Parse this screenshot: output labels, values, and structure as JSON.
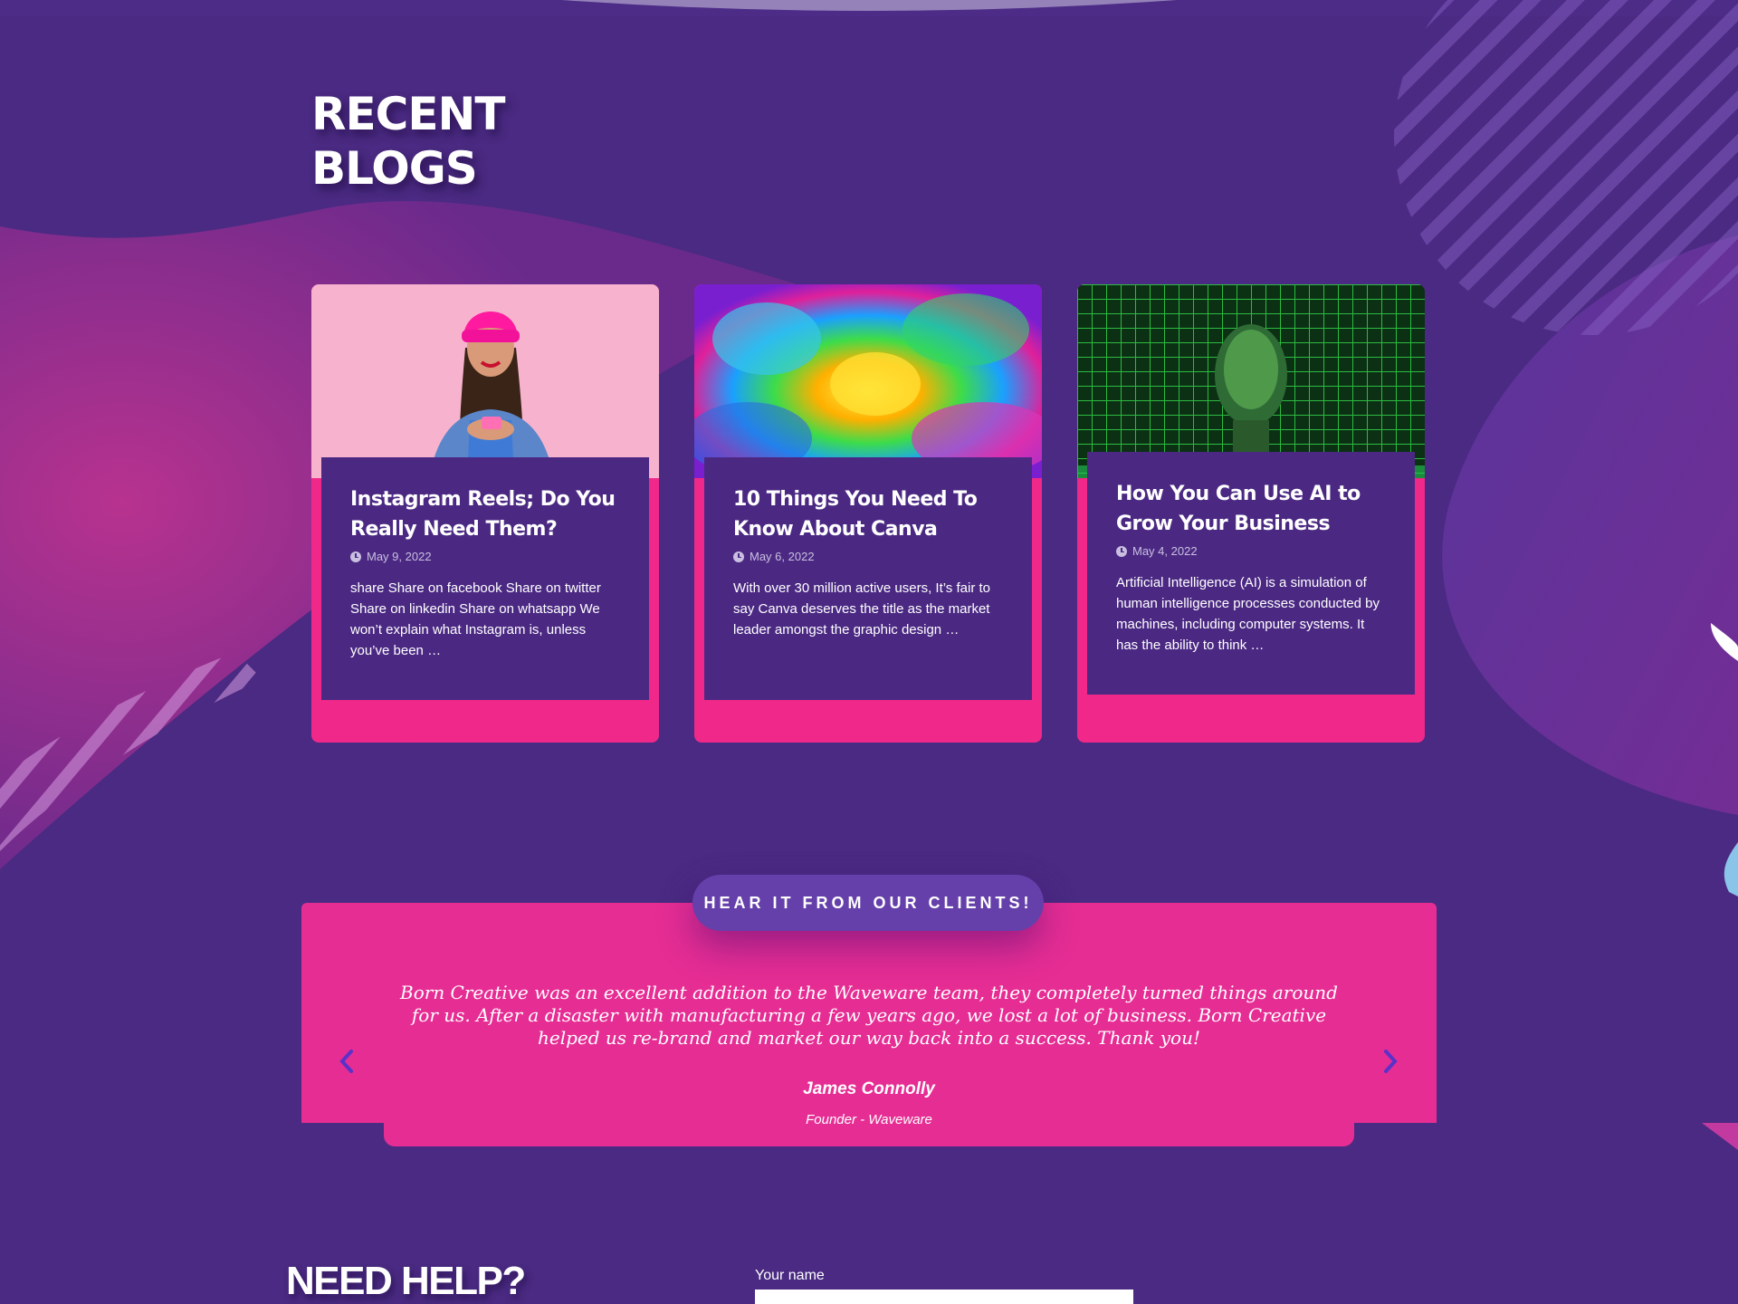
{
  "section": {
    "title_line1": "RECENT",
    "title_line2": "BLOGS"
  },
  "blogs": [
    {
      "title": "Instagram Reels; Do You Really Need Them?",
      "date": "May 9, 2022",
      "excerpt": "share Share on facebook Share on twitter Share on linkedin Share on whatsapp We won’t explain what Instagram is, unless you’ve been …",
      "image": "woman-with-phone-pink-beanie"
    },
    {
      "title": "10 Things You Need To Know About Canva",
      "date": "May 6, 2022",
      "excerpt": "With over 30 million active users, It’s fair to say Canva deserves the title as the market leader amongst the graphic design …",
      "image": "colorful-paint-explosion"
    },
    {
      "title": "How You Can Use AI to Grow Your Business",
      "date": "May 4, 2022",
      "excerpt": "Artificial Intelligence (AI) is a simulation of human intelligence processes conducted by machines, including computer systems. It has the ability to think …",
      "image": "green-digital-ai-face"
    }
  ],
  "testimonials": {
    "heading": "HEAR IT FROM OUR CLIENTS!",
    "quote": "Born Creative was an excellent addition to the Waveware team, they completely turned things around for us. After a disaster with manufacturing a few years ago, we lost a lot of business. Born Creative helped us re-brand and market our way back into a success. Thank you!",
    "author": "James Connolly",
    "role": "Founder - Waveware",
    "prev_icon": "chevron-left-icon",
    "next_icon": "chevron-right-icon"
  },
  "help": {
    "title": "NEED HELP?",
    "name_label": "Your name",
    "name_value": ""
  },
  "colors": {
    "background": "#4a2a82",
    "card_accent": "#f0288a",
    "card_body": "#4b2983",
    "testimonial_bg": "#e62d94",
    "pill": "#6540aa",
    "arrow": "#5a32c8"
  }
}
